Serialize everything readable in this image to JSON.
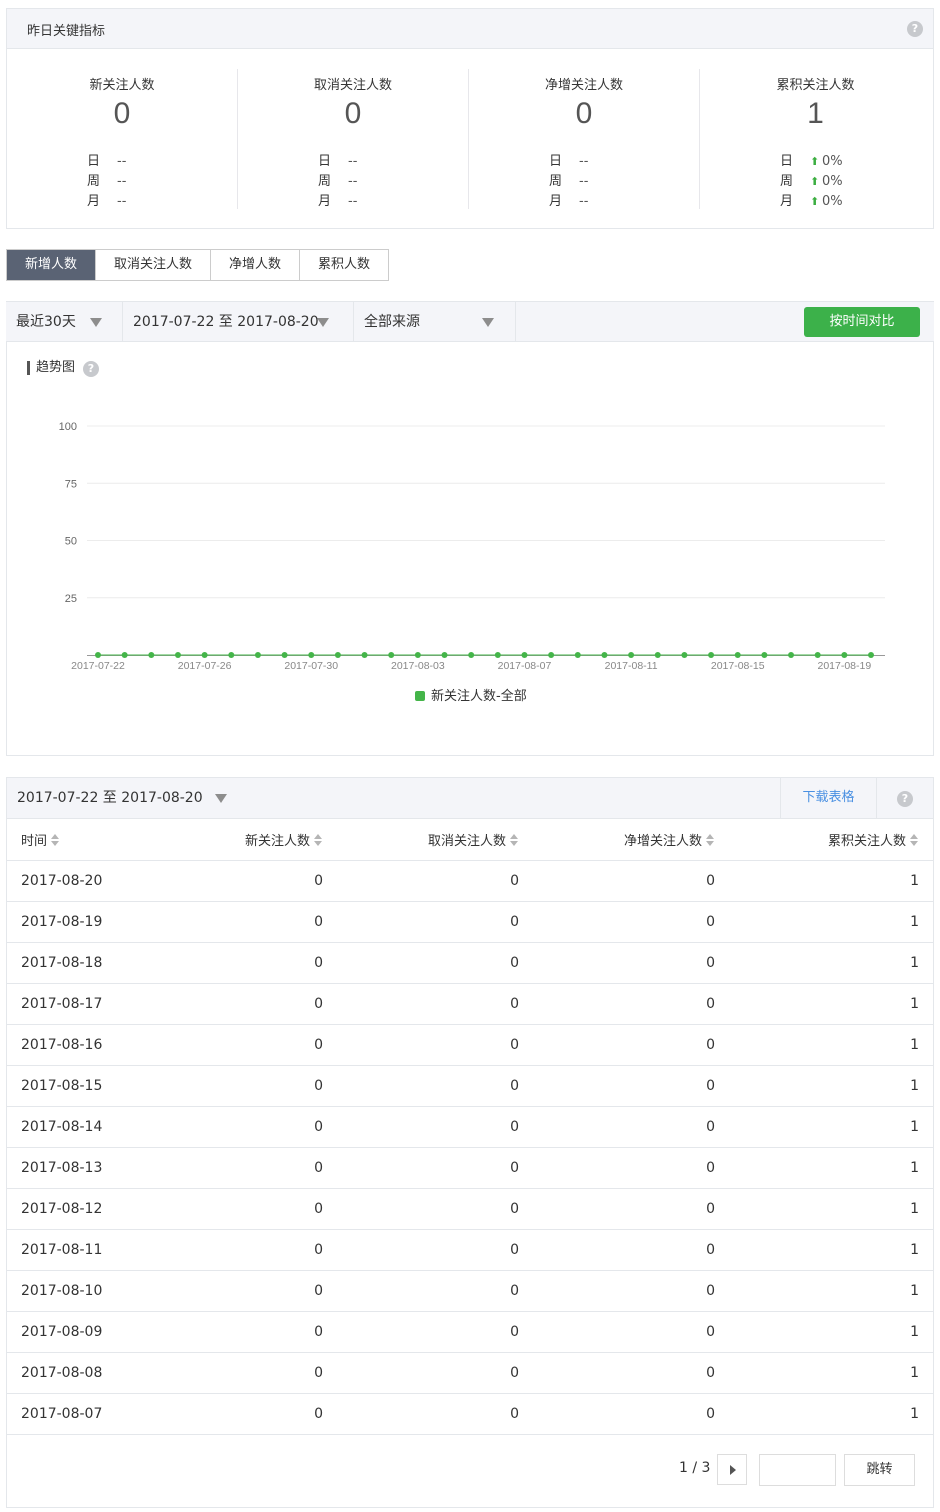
{
  "kpi": {
    "title": "昨日关键指标",
    "help": "?",
    "day_label": "日",
    "week_label": "周",
    "month_label": "月",
    "columns": [
      {
        "name": "新关注人数",
        "value": "0",
        "day": "--",
        "week": "--",
        "month": "--"
      },
      {
        "name": "取消关注人数",
        "value": "0",
        "day": "--",
        "week": "--",
        "month": "--"
      },
      {
        "name": "净增关注人数",
        "value": "0",
        "day": "--",
        "week": "--",
        "month": "--"
      },
      {
        "name": "累积关注人数",
        "value": "1",
        "day": "0%",
        "week": "0%",
        "month": "0%"
      }
    ],
    "up_color": "#3cae41"
  },
  "tabs": [
    "新增人数",
    "取消关注人数",
    "净增人数",
    "累积人数"
  ],
  "filters": {
    "period": "最近30天",
    "range": "2017-07-22 至 2017-08-20",
    "source": "全部来源",
    "compare_button": "按时间对比"
  },
  "chart_title": "趋势图",
  "chart_data": {
    "type": "line",
    "ylim": [
      0,
      100
    ],
    "yticks": [
      100,
      75,
      50,
      25
    ],
    "x_tick_labels": [
      "2017-07-22",
      "2017-07-26",
      "2017-07-30",
      "2017-08-03",
      "2017-08-07",
      "2017-08-11",
      "2017-08-15",
      "2017-08-19"
    ],
    "x": [
      "2017-07-22",
      "2017-07-23",
      "2017-07-24",
      "2017-07-25",
      "2017-07-26",
      "2017-07-27",
      "2017-07-28",
      "2017-07-29",
      "2017-07-30",
      "2017-07-31",
      "2017-08-01",
      "2017-08-02",
      "2017-08-03",
      "2017-08-04",
      "2017-08-05",
      "2017-08-06",
      "2017-08-07",
      "2017-08-08",
      "2017-08-09",
      "2017-08-10",
      "2017-08-11",
      "2017-08-12",
      "2017-08-13",
      "2017-08-14",
      "2017-08-15",
      "2017-08-16",
      "2017-08-17",
      "2017-08-18",
      "2017-08-19",
      "2017-08-20"
    ],
    "series": [
      {
        "name": "新关注人数-全部",
        "color": "#44b549",
        "values": [
          0,
          0,
          0,
          0,
          0,
          0,
          0,
          0,
          0,
          0,
          0,
          0,
          0,
          0,
          0,
          0,
          0,
          0,
          0,
          0,
          0,
          0,
          0,
          0,
          0,
          0,
          0,
          0,
          0,
          0
        ]
      }
    ],
    "grid": true,
    "legend": "bottom-center"
  },
  "table": {
    "range": "2017-07-22 至 2017-08-20",
    "download": "下载表格",
    "help": "?",
    "headers": [
      "时间",
      "新关注人数",
      "取消关注人数",
      "净增关注人数",
      "累积关注人数"
    ],
    "rows": [
      [
        "2017-08-20",
        "0",
        "0",
        "0",
        "1"
      ],
      [
        "2017-08-19",
        "0",
        "0",
        "0",
        "1"
      ],
      [
        "2017-08-18",
        "0",
        "0",
        "0",
        "1"
      ],
      [
        "2017-08-17",
        "0",
        "0",
        "0",
        "1"
      ],
      [
        "2017-08-16",
        "0",
        "0",
        "0",
        "1"
      ],
      [
        "2017-08-15",
        "0",
        "0",
        "0",
        "1"
      ],
      [
        "2017-08-14",
        "0",
        "0",
        "0",
        "1"
      ],
      [
        "2017-08-13",
        "0",
        "0",
        "0",
        "1"
      ],
      [
        "2017-08-12",
        "0",
        "0",
        "0",
        "1"
      ],
      [
        "2017-08-11",
        "0",
        "0",
        "0",
        "1"
      ],
      [
        "2017-08-10",
        "0",
        "0",
        "0",
        "1"
      ],
      [
        "2017-08-09",
        "0",
        "0",
        "0",
        "1"
      ],
      [
        "2017-08-08",
        "0",
        "0",
        "0",
        "1"
      ],
      [
        "2017-08-07",
        "0",
        "0",
        "0",
        "1"
      ]
    ]
  },
  "pager": {
    "page": "1 / 3",
    "jump": "跳转"
  }
}
